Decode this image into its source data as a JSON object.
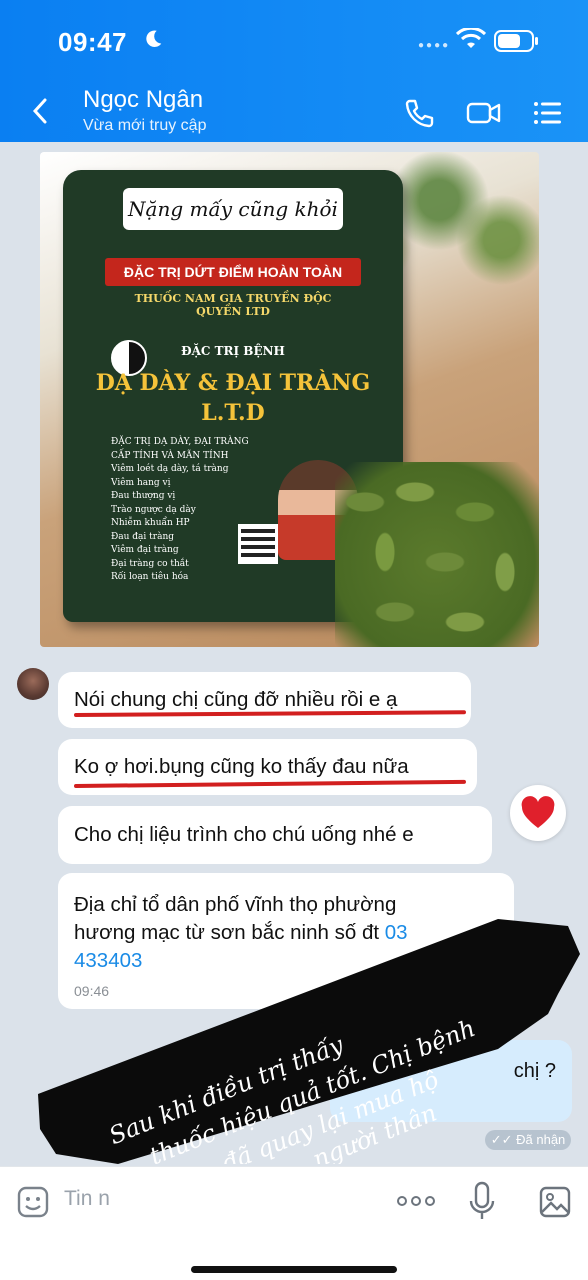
{
  "status_bar": {
    "time": "09:47"
  },
  "header": {
    "contact_name": "Ngọc Ngân",
    "contact_status": "Vừa mới truy cập"
  },
  "product_photo": {
    "label_handwritten": "Nặng mấy cũng khỏi",
    "red_banner": "ĐẶC TRỊ DỨT ĐIỂM HOÀN TOÀN",
    "line1": "THUỐC NAM GIA TRUYỀN ĐỘC QUYỀN LTD",
    "sub": "ĐẶC TRỊ BỆNH",
    "title": "DẠ DÀY & ĐẠI TRÀNG",
    "brand": "L.T.D",
    "list": [
      "ĐẶC TRỊ DẠ DÀY, ĐẠI TRÀNG",
      "CẤP TÍNH VÀ MÃN TÍNH",
      "Viêm loét dạ dày, tá tràng",
      "Viêm hang vị",
      "Đau thượng vị",
      "Trào ngược dạ dày",
      "Nhiễm khuẩn HP",
      "Đau đại tràng",
      "Viêm đại tràng",
      "Đại tràng co thắt",
      "Rối loạn tiêu hóa"
    ]
  },
  "messages": [
    {
      "text": "Nói chung chị cũng đỡ nhiều rồi e ạ"
    },
    {
      "text": "Ko ợ hơi.bụng cũng ko thấy đau nữa"
    },
    {
      "text": "Cho chị liệu trình cho chú uống nhé e"
    },
    {
      "text_line1": "Địa chỉ tổ dân phố vĩnh thọ phường",
      "text_line2": "hương mạc từ sơn bắc ninh số đt ",
      "phone_a": "03",
      "phone_b": "433403",
      "time": "09:46"
    }
  ],
  "outgoing_partial": "chị ?",
  "received_label": "Đã nhận",
  "overlay_text": {
    "line1": "Sau khi điều trị thấy",
    "line2": "thuốc hiệu quả tốt. Chị bệnh",
    "line3": "nhân đã quay lại mua hộ",
    "line4": "người thân"
  },
  "composer": {
    "placeholder": "Tin n"
  },
  "colors": {
    "header": "#0a7ff2",
    "accent": "#1a8be6",
    "underline": "#d21f1f",
    "overlay": "#0b0b0b"
  }
}
